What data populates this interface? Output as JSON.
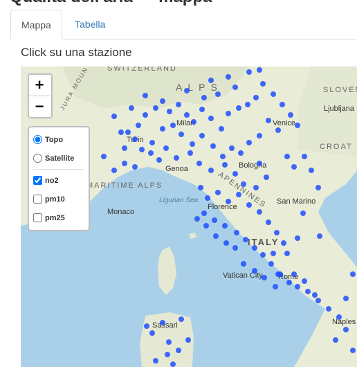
{
  "tabs": [
    {
      "label": "Mappa",
      "active": true
    },
    {
      "label": "Tabella",
      "active": false
    }
  ],
  "subtitle": "Click su una stazione",
  "map": {
    "zoom_in": "+",
    "zoom_out": "−",
    "base_layers": [
      {
        "label": "Topo",
        "selected": true
      },
      {
        "label": "Satellite",
        "selected": false
      }
    ],
    "overlays": [
      {
        "label": "no2",
        "checked": true
      },
      {
        "label": "pm10",
        "checked": false
      },
      {
        "label": "pm25",
        "checked": false
      }
    ],
    "place_labels": [
      "SWITZERLAND",
      "ALPS",
      "SLOVEN",
      "Ljubljana",
      "Milan",
      "Venice",
      "Turin",
      "CROAT",
      "Genoa",
      "Bologna",
      "MARITIME ALPS",
      "Ligurian Sea",
      "Florence",
      "San Marino",
      "Monaco",
      "APENNINES",
      "ITALY",
      "Vatican City",
      "Rome",
      "Naples",
      "Sassari",
      "JURA MOUNTAINS"
    ],
    "colors": {
      "station": "#1f4fff",
      "sea": "#a9d0e8",
      "land": "#e8ecd8"
    }
  }
}
